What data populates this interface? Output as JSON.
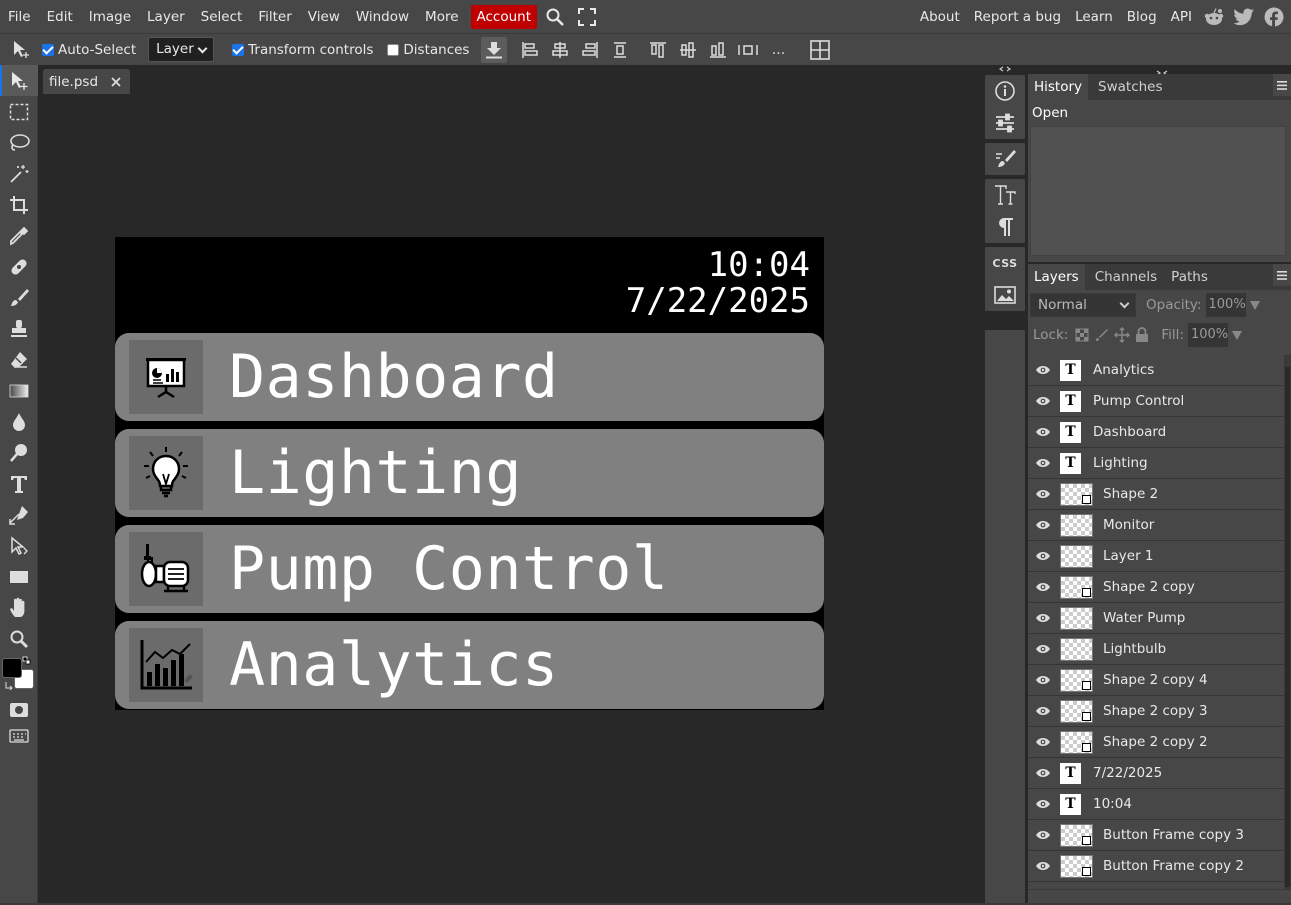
{
  "menubar": {
    "items": [
      "File",
      "Edit",
      "Image",
      "Layer",
      "Select",
      "Filter",
      "View",
      "Window",
      "More"
    ],
    "account": "Account",
    "right_links": [
      "About",
      "Report a bug",
      "Learn",
      "Blog",
      "API"
    ],
    "social_icons": [
      "reddit-icon",
      "twitter-icon",
      "facebook-icon"
    ]
  },
  "options": {
    "auto_select_label": "Auto-Select",
    "auto_select_checked": true,
    "layer_select_value": "Layer",
    "transform_controls_label": "Transform controls",
    "transform_controls_checked": true,
    "distances_label": "Distances",
    "distances_checked": false,
    "more_label": "..."
  },
  "document": {
    "tab_name": "file.psd",
    "clock_time": "10:04",
    "clock_date": "7/22/2025",
    "buttons": [
      {
        "label": "Dashboard",
        "icon": "monitor-chart-icon"
      },
      {
        "label": "Lighting",
        "icon": "lightbulb-icon"
      },
      {
        "label": "Pump Control",
        "icon": "water-pump-icon"
      },
      {
        "label": "Analytics",
        "icon": "analytics-chart-icon"
      }
    ]
  },
  "history": {
    "tabs": [
      "History",
      "Swatches"
    ],
    "items": [
      "Open"
    ]
  },
  "layers": {
    "tabs": [
      "Layers",
      "Channels",
      "Paths"
    ],
    "blend_mode": "Normal",
    "opacity_label": "Opacity:",
    "opacity_value": "100%",
    "lock_label": "Lock:",
    "fill_label": "Fill:",
    "fill_value": "100%",
    "items": [
      {
        "name": "Analytics",
        "type": "text"
      },
      {
        "name": "Pump Control",
        "type": "text"
      },
      {
        "name": "Dashboard",
        "type": "text"
      },
      {
        "name": "Lighting",
        "type": "text"
      },
      {
        "name": "Shape 2",
        "type": "shape"
      },
      {
        "name": "Monitor",
        "type": "raster"
      },
      {
        "name": "Layer 1",
        "type": "raster"
      },
      {
        "name": "Shape 2 copy",
        "type": "shape"
      },
      {
        "name": "Water Pump",
        "type": "raster"
      },
      {
        "name": "Lightbulb",
        "type": "raster"
      },
      {
        "name": "Shape 2 copy 4",
        "type": "shape"
      },
      {
        "name": "Shape 2 copy 3",
        "type": "shape"
      },
      {
        "name": "Shape 2 copy 2",
        "type": "shape"
      },
      {
        "name": "7/22/2025",
        "type": "text"
      },
      {
        "name": "10:04",
        "type": "text"
      },
      {
        "name": "Button Frame copy 3",
        "type": "shape"
      },
      {
        "name": "Button Frame copy 2",
        "type": "shape"
      }
    ]
  },
  "rail": {
    "css_label": "CSS"
  },
  "colors": {
    "accent": "#1a73e8",
    "account_red": "#c00000",
    "button_frame": "#808080",
    "foreground": "#000000",
    "background": "#ffffff"
  }
}
